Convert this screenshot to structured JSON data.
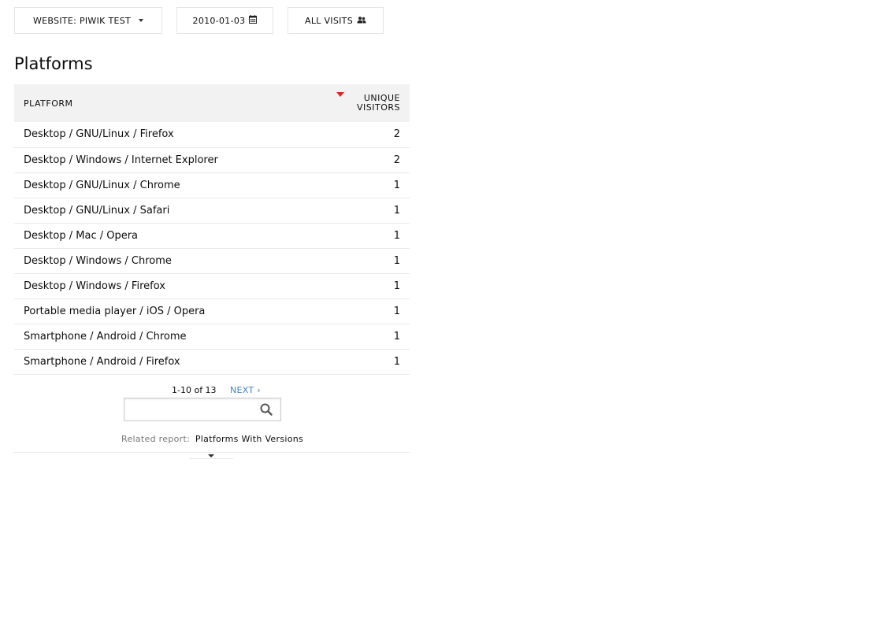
{
  "toolbar": {
    "website_label": "WEBSITE: PIWIK TEST",
    "date_label": "2010-01-03",
    "segment_label": "ALL VISITS"
  },
  "report": {
    "title": "Platforms",
    "columns": {
      "label": "PLATFORM",
      "metric_line1": "UNIQUE",
      "metric_line2": "VISITORS"
    },
    "rows": [
      {
        "label": "Desktop / GNU/Linux / Firefox",
        "value": "2"
      },
      {
        "label": "Desktop / Windows / Internet Explorer",
        "value": "2"
      },
      {
        "label": "Desktop / GNU/Linux / Chrome",
        "value": "1"
      },
      {
        "label": "Desktop / GNU/Linux / Safari",
        "value": "1"
      },
      {
        "label": "Desktop / Mac / Opera",
        "value": "1"
      },
      {
        "label": "Desktop / Windows / Chrome",
        "value": "1"
      },
      {
        "label": "Desktop / Windows / Firefox",
        "value": "1"
      },
      {
        "label": "Portable media player / iOS / Opera",
        "value": "1"
      },
      {
        "label": "Smartphone / Android / Chrome",
        "value": "1"
      },
      {
        "label": "Smartphone / Android / Firefox",
        "value": "1"
      }
    ],
    "pagination": {
      "count": "1-10 of 13",
      "next": "NEXT ›"
    },
    "search": {
      "value": "",
      "placeholder": ""
    },
    "related": {
      "label": "Related report:",
      "link": "Platforms With Versions"
    }
  },
  "colors": {
    "sort_arrow": "#d4291f",
    "link": "#4183c4",
    "header_bg": "#f2f2f2"
  },
  "icons": {
    "website": "caret-down-icon",
    "date": "calendar-icon",
    "segment": "users-icon",
    "search": "search-icon",
    "footer": "chevron-down-icon"
  }
}
